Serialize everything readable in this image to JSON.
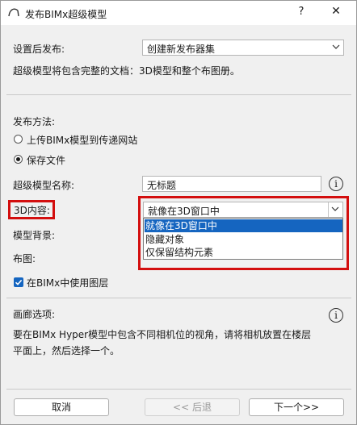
{
  "window": {
    "title": "发布BIMx超级模型",
    "help_label": "?",
    "close_label": "✕"
  },
  "publish_after": {
    "label": "设置后发布:",
    "value": "创建新发布器集"
  },
  "description": "超级模型将包含完整的文档：3D模型和整个布图册。",
  "publish_method": {
    "label": "发布方法:",
    "options": [
      {
        "label": "上传BIMx模型到传递网站",
        "selected": false
      },
      {
        "label": "保存文件",
        "selected": true
      }
    ]
  },
  "hypermodel_name": {
    "label": "超级模型名称:",
    "value": "无标题"
  },
  "content_3d": {
    "label": "3D内容:",
    "value": "就像在3D窗口中",
    "options": [
      "就像在3D窗口中",
      "隐藏对象",
      "仅保留结构元素"
    ],
    "selected_index": 0
  },
  "model_background": {
    "label": "模型背景:"
  },
  "layout": {
    "label": "布图:"
  },
  "use_layers": {
    "label": "在BIMx中使用图层",
    "checked": true
  },
  "gallery": {
    "label": "画廊选项:",
    "text_line1": "要在BIMx Hyper模型中包含不同相机位的视角，请将相机放置在楼层",
    "text_line2": "平面上，然后选择一个。"
  },
  "buttons": {
    "cancel": "取消",
    "back": "<< 后退",
    "next": "下一个>>"
  },
  "colors": {
    "accent": "#1565c0",
    "highlight": "#d30e0e"
  }
}
